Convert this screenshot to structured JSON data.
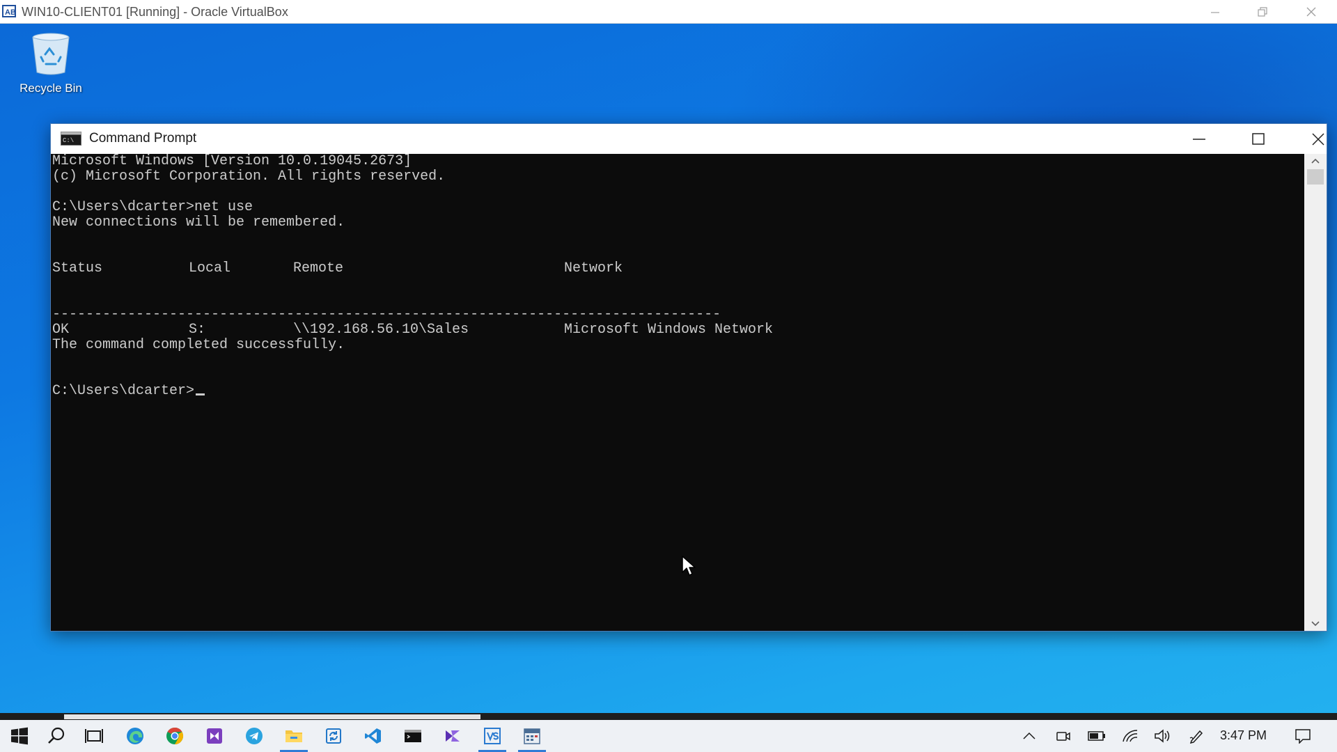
{
  "host": {
    "title": "WIN10-CLIENT01 [Running] - Oracle VirtualBox",
    "controls": [
      "minimize",
      "restore",
      "close"
    ]
  },
  "desktop": {
    "icons": [
      {
        "label": "Recycle Bin",
        "icon": "recycle-bin-icon"
      }
    ]
  },
  "cmd": {
    "title": "Command Prompt",
    "lines": [
      "Microsoft Windows [Version 10.0.19045.2673]",
      "(c) Microsoft Corporation. All rights reserved.",
      "",
      "C:\\Users\\dcarter>net use",
      "New connections will be remembered.",
      "",
      "",
      "",
      "",
      "--------------------------------------------------------------------------------",
      "",
      "The command completed successfully.",
      "",
      "",
      ""
    ],
    "table": {
      "headers": {
        "status": "Status",
        "local": "Local",
        "remote": "Remote",
        "network": "Network"
      },
      "rows": [
        {
          "status": "OK",
          "local": "S:",
          "remote": "\\\\192.168.56.10\\Sales",
          "network": "Microsoft Windows Network"
        }
      ]
    },
    "prompt": "C:\\Users\\dcarter>"
  },
  "taskbar": {
    "pinned": [
      "windows-start-icon",
      "search-icon",
      "task-view-icon",
      "edge-icon",
      "chrome-icon",
      "visual-studio-icon",
      "telegram-icon",
      "file-explorer-icon",
      "sync-app-icon",
      "vscode-icon",
      "terminal-icon",
      "power-automate-icon",
      "vs-installer-icon",
      "calendar-app-icon"
    ],
    "tray": [
      "chevron-up-icon",
      "meet-now-icon",
      "battery-icon",
      "wifi-icon",
      "volume-icon",
      "pen-icon"
    ],
    "clock": "3:47 PM",
    "notification": "notification-icon"
  },
  "colors": {
    "desktop": "#0d78e2",
    "console_bg": "#0c0c0c",
    "console_text": "#cccccc",
    "taskbar_bg": "#eef1f5",
    "accent": "#2f7bd6"
  }
}
